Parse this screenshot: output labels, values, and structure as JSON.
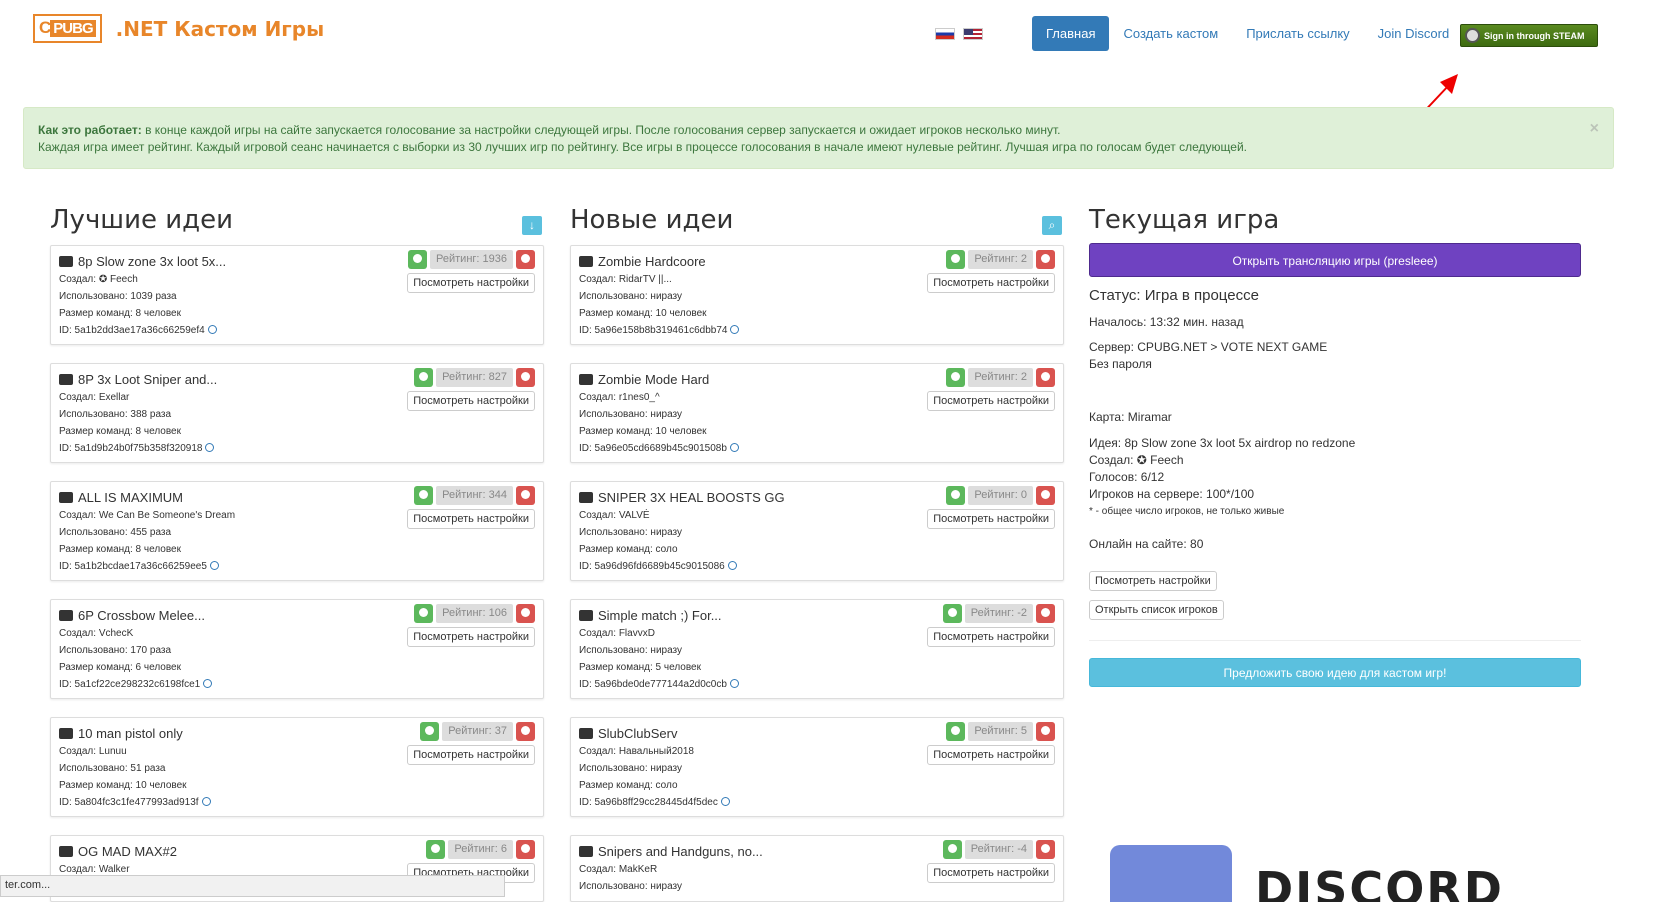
{
  "logo": {
    "box_text": "C",
    "box_text2": "PUBG",
    "site_name": ".NET Кастом Игры"
  },
  "nav": {
    "home": "Главная",
    "create": "Создать кастом",
    "send_link": "Прислать ссылку",
    "discord": "Join Discord",
    "steam": "Sign in through STEAM"
  },
  "alert": {
    "bold": "Как это работает:",
    "line1": " в конце каждой игры на сайте запускается голосование за настройки следующей игры. После голосования сервер запускается и ожидает игроков несколько минут.",
    "line2": "Каждая игра имеет рейтинг. Каждый игровой сеанс начинается с выборки из 30 лучших игр по рейтингу. Все игры в процессе голосования в начале имеют нулевые рейтинг. Лучшая игра по голосам будет следующей.",
    "close": "×"
  },
  "columns": {
    "best": "Лучшие идеи",
    "new": "Новые идеи",
    "current": "Текущая игра"
  },
  "settings_label": "Посмотреть настройки",
  "best": [
    {
      "title": "8p Slow zone 3x loot 5x...",
      "author": "Создал: ✪ Feech",
      "used": "Использовано: 1039 раза",
      "team": "Размер команд: 8 человек",
      "id": "ID: 5a1b2dd3ae17a36c66259ef4",
      "rating": "Рейтинг: 1936"
    },
    {
      "title": "8P 3x Loot Sniper and...",
      "author": "Создал: Exellar",
      "used": "Использовано: 388 раза",
      "team": "Размер команд: 8 человек",
      "id": "ID: 5a1d9b24b0f75b358f320918",
      "rating": "Рейтинг: 827"
    },
    {
      "title": "ALL IS MAXIMUM",
      "author": "Создал: We Can Be Someone's Dream",
      "used": "Использовано: 455 раза",
      "team": "Размер команд: 8 человек",
      "id": "ID: 5a1b2bcdae17a36c66259ee5",
      "rating": "Рейтинг: 344"
    },
    {
      "title": "6P Crossbow Melee...",
      "author": "Создал: VcheсK",
      "used": "Использовано: 170 раза",
      "team": "Размер команд: 6 человек",
      "id": "ID: 5a1cf22ce298232c6198fce1",
      "rating": "Рейтинг: 106"
    },
    {
      "title": "10 man pistol only",
      "author": "Создал: Lunuu",
      "used": "Использовано: 51 раза",
      "team": "Размер команд: 10 человек",
      "id": "ID: 5a804fc3c1fe477993ad913f",
      "rating": "Рейтинг: 37"
    },
    {
      "title": "OG MAD MAX#2",
      "author": "Создал: Walker",
      "used": "",
      "team": "",
      "id": "",
      "rating": "Рейтинг: 6"
    }
  ],
  "new": [
    {
      "title": "Zombie Hardcoore",
      "author": "Создал: RidarTV ||...",
      "used": "Использовано: ниразу",
      "team": "Размер команд: 10 человек",
      "id": "ID: 5a96e158b8b319461c6dbb74",
      "rating": "Рейтинг: 2"
    },
    {
      "title": "Zombie Mode Hard",
      "author": "Создал: r1nes0_^",
      "used": "Использовано: ниразу",
      "team": "Размер команд: 10 человек",
      "id": "ID: 5a96e05cd6689b45c901508b",
      "rating": "Рейтинг: 2"
    },
    {
      "title": "SNIPER 3X HEAL BOOSTS GG",
      "author": "Создал: VALVĖ",
      "used": "Использовано: ниразу",
      "team": "Размер команд: соло",
      "id": "ID: 5a96d96fd6689b45c9015086",
      "rating": "Рейтинг: 0"
    },
    {
      "title": "Simple match ;) For...",
      "author": "Создал: FlavvxD",
      "used": "Использовано: ниразу",
      "team": "Размер команд: 5 человек",
      "id": "ID: 5a96bde0de777144a2d0c0cb",
      "rating": "Рейтинг: -2"
    },
    {
      "title": "SlubClubServ",
      "author": "Создал: Навальный2018",
      "used": "Использовано: ниразу",
      "team": "Размер команд: соло",
      "id": "ID: 5a96b8ff29cc28445d4f5dec",
      "rating": "Рейтинг: 5"
    },
    {
      "title": "Snipers and Handguns, no...",
      "author": "Создал: MakKeR",
      "used": "Использовано: ниразу",
      "team": "",
      "id": "",
      "rating": "Рейтинг: -4"
    }
  ],
  "current": {
    "stream_btn": "Открыть трансляцию игры (presleee)",
    "status": "Статус: Игра в процессе",
    "started": "Началось: 13:32 мин. назад",
    "server": "Сервер: CPUBG.NET > VOTE NEXT GAME",
    "password": "Без пароля",
    "map": "Карта: Miramar",
    "idea": "Идея: 8p Slow zone 3x loot 5x airdrop no redzone",
    "author": "Создал: ✪ Feech",
    "votes": "Голосов: 6/12",
    "players": "Игроков на сервере: 100*/100",
    "note": "* - общее число игроков, не только живые",
    "online": "Онлайн на сайте: 80",
    "view_settings": "Посмотреть настройки",
    "player_list": "Открыть список игроков",
    "suggest": "Предложить свою идею для кастом игр!"
  },
  "discord_text": "DISCORD",
  "statusbar": "ter.com..."
}
